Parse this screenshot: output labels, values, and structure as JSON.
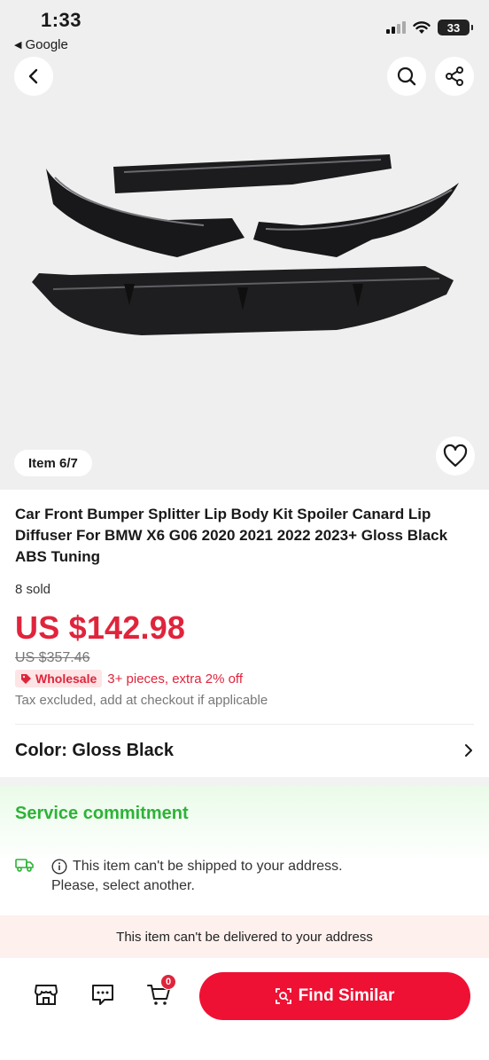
{
  "status_bar": {
    "time": "1:33",
    "back_app": "Google",
    "battery": "33"
  },
  "gallery": {
    "item_counter": "Item 6/7",
    "icons": [
      "back-arrow",
      "search",
      "share",
      "heart"
    ]
  },
  "product": {
    "title": "Car Front Bumper Splitter Lip Body Kit Spoiler Canard Lip Diffuser For BMW X6 G06 2020 2021 2022 2023+ Gloss Black ABS Tuning",
    "sold": "8 sold",
    "price": "US $142.98",
    "original_price": "US $357.46",
    "wholesale_badge": "Wholesale",
    "wholesale_text": "3+ pieces, extra 2% off",
    "tax_note": "Tax excluded, add at checkout if applicable"
  },
  "color": {
    "label": "Color: Gloss Black"
  },
  "service": {
    "title": "Service commitment",
    "ship_line1": "This item can't be shipped to your address.",
    "ship_line2": "Please, select another."
  },
  "notice": "This item can't be delivered to your address",
  "bottom_bar": {
    "cart_count": "0",
    "find_similar": "Find Similar"
  },
  "colors": {
    "accent_red": "#e0243c",
    "button_red": "#ee1133",
    "service_green": "#2cb336"
  }
}
